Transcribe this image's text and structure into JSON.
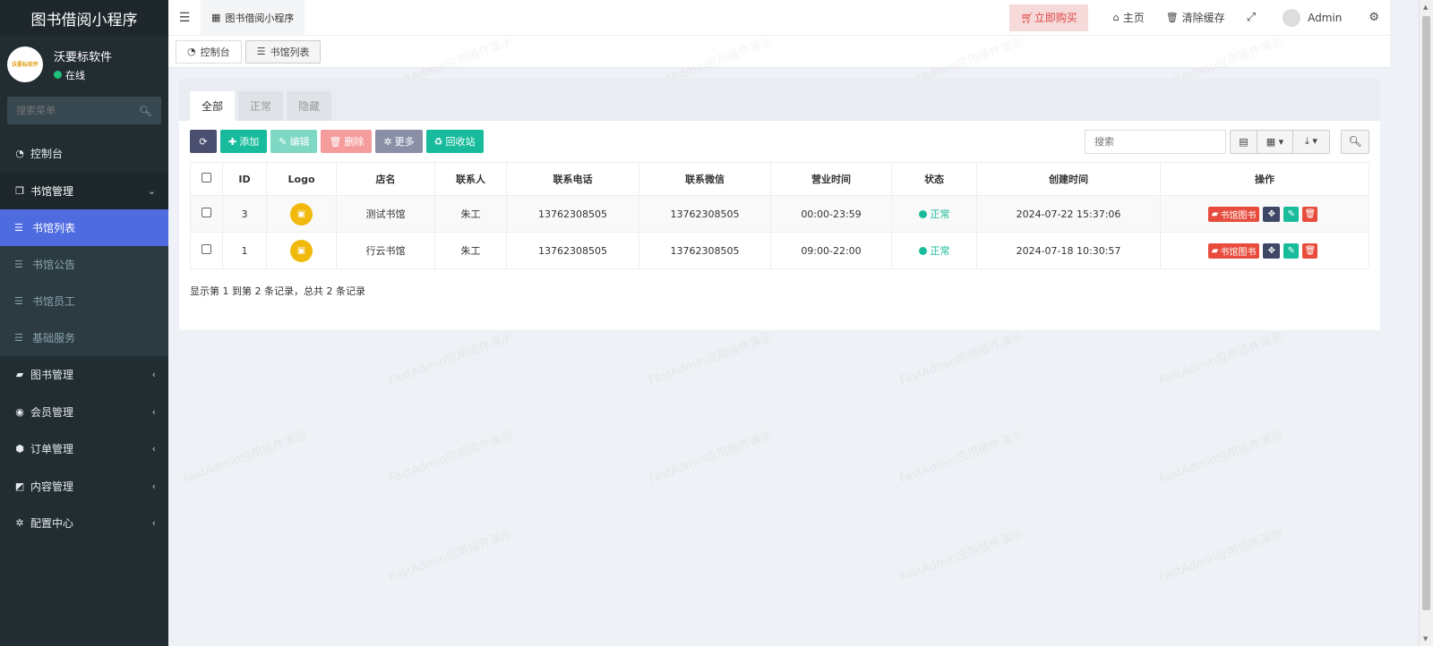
{
  "sidebar": {
    "brand": "图书借阅小程序",
    "avatar_text": "沃要标软件",
    "user_name": "沃要标软件",
    "user_status": "在线",
    "search_placeholder": "搜索菜单",
    "menu": [
      {
        "label": "控制台",
        "icon": "dashboard-icon"
      },
      {
        "label": "书馆管理",
        "icon": "clone-icon",
        "open": true,
        "children": [
          "书馆列表",
          "书馆公告",
          "书馆员工",
          "基础服务"
        ]
      },
      {
        "label": "图书管理",
        "icon": "book-icon"
      },
      {
        "label": "会员管理",
        "icon": "user-circle-icon"
      },
      {
        "label": "订单管理",
        "icon": "cube-icon"
      },
      {
        "label": "内容管理",
        "icon": "edit-icon"
      },
      {
        "label": "配置中心",
        "icon": "gear-icon"
      }
    ]
  },
  "header": {
    "app_tab": "图书借阅小程序",
    "buy": "立即购买",
    "home": "主页",
    "clear_cache": "清除缓存",
    "admin": "Admin"
  },
  "navtabs": [
    "控制台",
    "书馆列表"
  ],
  "panel": {
    "tabs": [
      "全部",
      "正常",
      "隐藏"
    ],
    "toolbar": {
      "add": "添加",
      "edit": "编辑",
      "delete": "删除",
      "more": "更多",
      "recycle": "回收站",
      "search_placeholder": "搜索"
    },
    "columns": [
      "ID",
      "Logo",
      "店名",
      "联系人",
      "联系电话",
      "联系微信",
      "营业时间",
      "状态",
      "创建时间",
      "操作"
    ],
    "rows": [
      {
        "id": "3",
        "name": "测试书馆",
        "contact": "朱工",
        "phone": "13762308505",
        "wechat": "13762308505",
        "hours": "00:00-23:59",
        "status": "正常",
        "created": "2024-07-22 15:37:06"
      },
      {
        "id": "1",
        "name": "行云书馆",
        "contact": "朱工",
        "phone": "13762308505",
        "wechat": "13762308505",
        "hours": "09:00-22:00",
        "status": "正常",
        "created": "2024-07-18 10:30:57"
      }
    ],
    "row_action_books": "书馆图书",
    "pager_info": "显示第 1 到第 2 条记录，总共 2 条记录"
  },
  "watermark": "FastAdmin应用插件演示",
  "colors": {
    "sidebar": "#222d32",
    "active_menu": "#4f6be0",
    "success": "#18bc9c",
    "danger": "#e74c3c"
  }
}
